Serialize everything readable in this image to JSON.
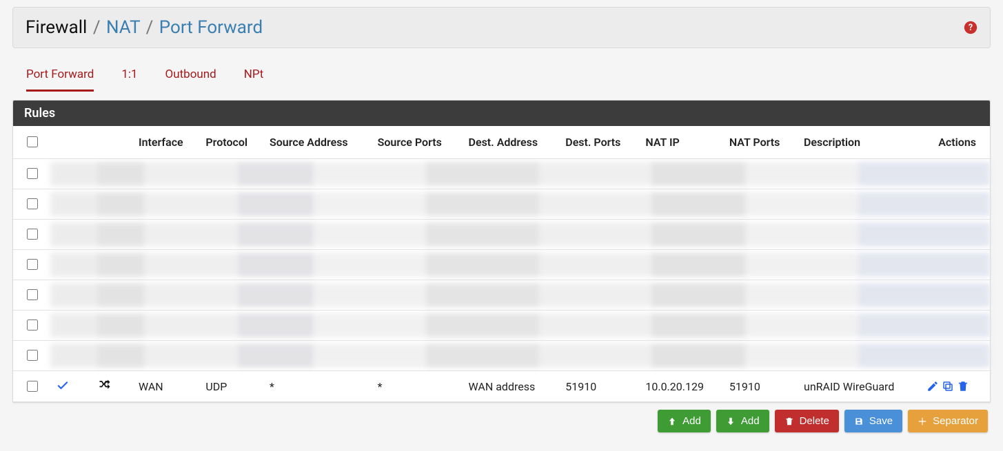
{
  "breadcrumb": {
    "root": "Firewall",
    "mid": "NAT",
    "leaf": "Port Forward"
  },
  "tabs": [
    "Port Forward",
    "1:1",
    "Outbound",
    "NPt"
  ],
  "active_tab_index": 0,
  "panel_title": "Rules",
  "columns": [
    "Interface",
    "Protocol",
    "Source Address",
    "Source Ports",
    "Dest. Address",
    "Dest. Ports",
    "NAT IP",
    "NAT Ports",
    "Description",
    "Actions"
  ],
  "blurred_row_count": 7,
  "rule": {
    "interface": "WAN",
    "protocol": "UDP",
    "source_address": "*",
    "source_ports": "*",
    "dest_address": "WAN address",
    "dest_ports": "51910",
    "nat_ip": "10.0.20.129",
    "nat_ports": "51910",
    "description": "unRAID WireGuard"
  },
  "buttons": {
    "add_up": "Add",
    "add_down": "Add",
    "delete": "Delete",
    "save": "Save",
    "separator": "Separator"
  }
}
